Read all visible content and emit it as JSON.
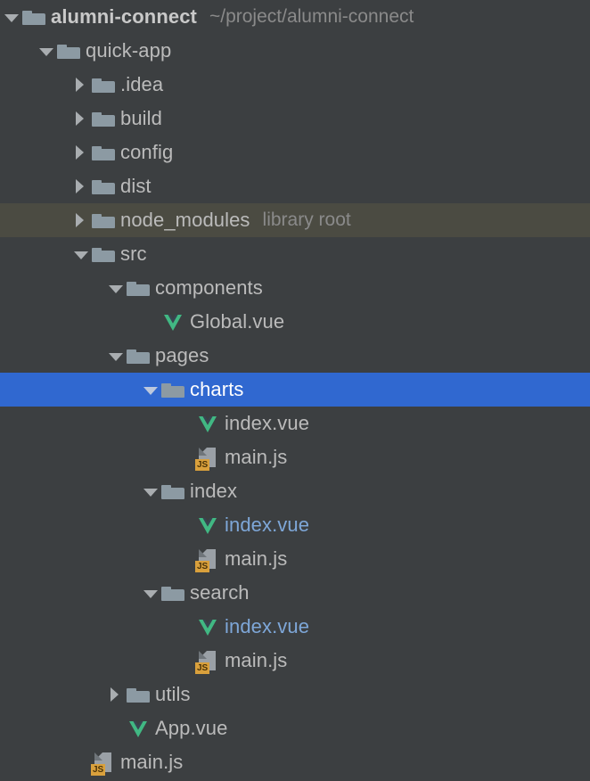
{
  "panel": {
    "name": "project-tool-window",
    "background": "#3c3f41",
    "selection_color": "#3068d0",
    "library_row_color": "#4b4b42",
    "vue_icon_color": "#41b883",
    "js_badge_color": "#d9a03c",
    "folder_icon_color": "#8c9aa3"
  },
  "rows": [
    {
      "label": "alumni-connect",
      "secondary": "~/project/alumni-connect",
      "icon": "folder-icon",
      "twisty": "expanded",
      "depth": 0,
      "bold": true,
      "state": "normal"
    },
    {
      "label": "quick-app",
      "secondary": "",
      "icon": "folder-icon",
      "twisty": "expanded",
      "depth": 1,
      "bold": false,
      "state": "normal"
    },
    {
      "label": ".idea",
      "secondary": "",
      "icon": "folder-icon",
      "twisty": "collapsed",
      "depth": 2,
      "bold": false,
      "state": "normal"
    },
    {
      "label": "build",
      "secondary": "",
      "icon": "folder-icon",
      "twisty": "collapsed",
      "depth": 2,
      "bold": false,
      "state": "normal"
    },
    {
      "label": "config",
      "secondary": "",
      "icon": "folder-icon",
      "twisty": "collapsed",
      "depth": 2,
      "bold": false,
      "state": "normal"
    },
    {
      "label": "dist",
      "secondary": "",
      "icon": "folder-icon",
      "twisty": "collapsed",
      "depth": 2,
      "bold": false,
      "state": "normal"
    },
    {
      "label": "node_modules",
      "secondary": "library root",
      "icon": "folder-icon",
      "twisty": "collapsed",
      "depth": 2,
      "bold": false,
      "state": "library"
    },
    {
      "label": "src",
      "secondary": "",
      "icon": "folder-icon",
      "twisty": "expanded",
      "depth": 2,
      "bold": false,
      "state": "normal"
    },
    {
      "label": "components",
      "secondary": "",
      "icon": "folder-icon",
      "twisty": "expanded",
      "depth": 3,
      "bold": false,
      "state": "normal"
    },
    {
      "label": "Global.vue",
      "secondary": "",
      "icon": "vue-icon",
      "twisty": "none",
      "depth": 4,
      "bold": false,
      "state": "normal"
    },
    {
      "label": "pages",
      "secondary": "",
      "icon": "folder-icon",
      "twisty": "expanded",
      "depth": 3,
      "bold": false,
      "state": "normal"
    },
    {
      "label": "charts",
      "secondary": "",
      "icon": "folder-icon",
      "twisty": "expanded",
      "depth": 4,
      "bold": false,
      "state": "selected"
    },
    {
      "label": "index.vue",
      "secondary": "",
      "icon": "vue-icon",
      "twisty": "none",
      "depth": 5,
      "bold": false,
      "state": "normal"
    },
    {
      "label": "main.js",
      "secondary": "",
      "icon": "js-icon",
      "twisty": "none",
      "depth": 5,
      "bold": false,
      "state": "normal"
    },
    {
      "label": "index",
      "secondary": "",
      "icon": "folder-icon",
      "twisty": "expanded",
      "depth": 4,
      "bold": false,
      "state": "normal"
    },
    {
      "label": "index.vue",
      "secondary": "",
      "icon": "vue-icon",
      "twisty": "none",
      "depth": 5,
      "bold": false,
      "state": "open"
    },
    {
      "label": "main.js",
      "secondary": "",
      "icon": "js-icon",
      "twisty": "none",
      "depth": 5,
      "bold": false,
      "state": "normal"
    },
    {
      "label": "search",
      "secondary": "",
      "icon": "folder-icon",
      "twisty": "expanded",
      "depth": 4,
      "bold": false,
      "state": "normal"
    },
    {
      "label": "index.vue",
      "secondary": "",
      "icon": "vue-icon",
      "twisty": "none",
      "depth": 5,
      "bold": false,
      "state": "open"
    },
    {
      "label": "main.js",
      "secondary": "",
      "icon": "js-icon",
      "twisty": "none",
      "depth": 5,
      "bold": false,
      "state": "normal"
    },
    {
      "label": "utils",
      "secondary": "",
      "icon": "folder-icon",
      "twisty": "collapsed",
      "depth": 3,
      "bold": false,
      "state": "normal"
    },
    {
      "label": "App.vue",
      "secondary": "",
      "icon": "vue-icon",
      "twisty": "none",
      "depth": 3,
      "bold": false,
      "state": "normal"
    },
    {
      "label": "main.js",
      "secondary": "",
      "icon": "js-icon",
      "twisty": "none",
      "depth": 2,
      "bold": false,
      "state": "normal"
    }
  ],
  "js_badge_text": "JS"
}
